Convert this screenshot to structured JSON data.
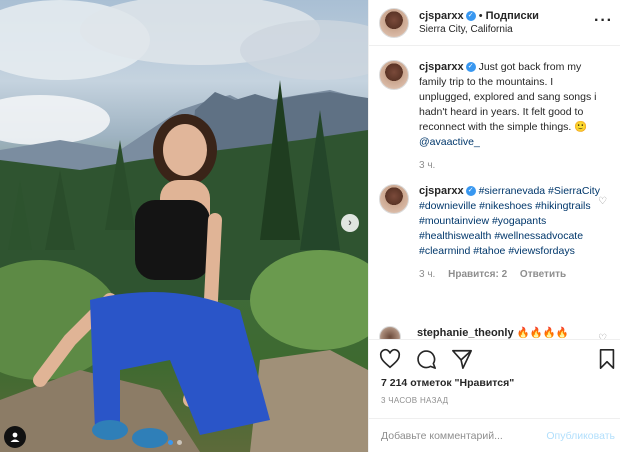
{
  "colors": {
    "link": "#00376b",
    "verified": "#3897f0",
    "muted": "#8e8e8e",
    "publish_disabled": "#b2dffc"
  },
  "media": {
    "next_icon": "chevron-right-icon",
    "tag_icon": "user-tag-icon",
    "slide_count": 2,
    "active_slide": 1
  },
  "header": {
    "username": "cjsparxx",
    "separator": " • ",
    "follow_label": "Подписки",
    "location": "Sierra City, California"
  },
  "caption": {
    "username": "cjsparxx",
    "text": "Just got back from my family trip to the mountains. I unplugged, explored and sang songs i hadn't heard in years. It felt good to reconnect with the simple things. 🙂",
    "mention": "@avaactive_",
    "time": "3 ч."
  },
  "comment2": {
    "username": "cjsparxx",
    "tags": [
      "#sierranevada",
      "#SierraCity",
      "#downieville",
      "#nikeshoes",
      "#hikingtrails",
      "#mountainview",
      "#yogapants",
      "#healthiswealth",
      "#wellnessadvocate",
      "#clearmind",
      "#tahoe",
      "#viewsfordays"
    ],
    "time": "3 ч.",
    "likes": "Нравится: 2",
    "reply": "Ответить"
  },
  "comment3": {
    "username": "stephanie_theonly",
    "text": "🔥🔥🔥🔥"
  },
  "actions": {
    "likes": "7 214 отметок \"Нравится\"",
    "timestamp": "3 ЧАСОВ НАЗАД",
    "comment_placeholder": "Добавьте комментарий...",
    "publish_label": "Опубликовать"
  }
}
